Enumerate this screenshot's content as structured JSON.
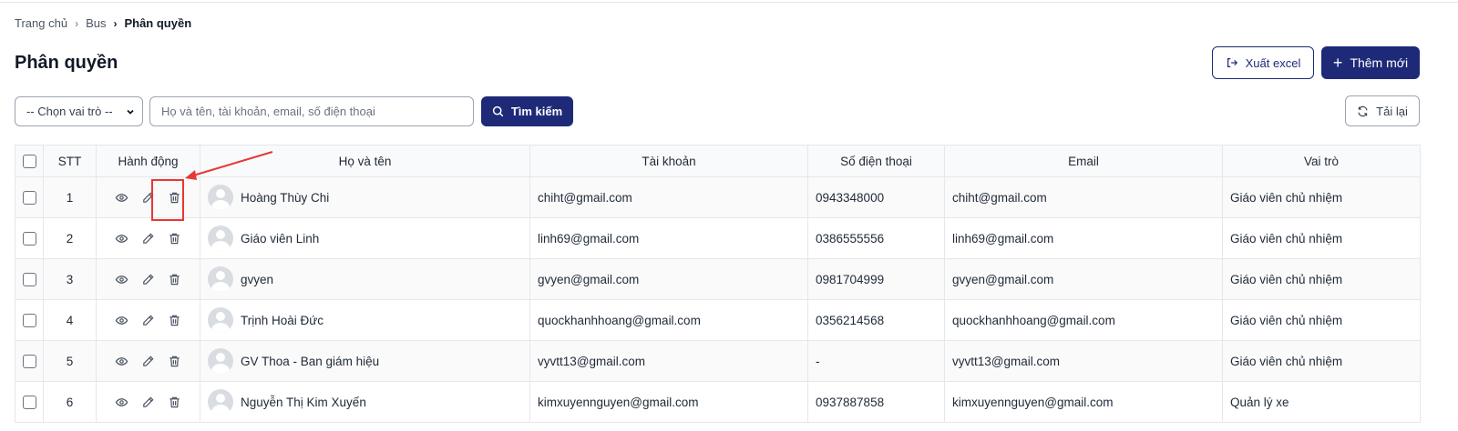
{
  "breadcrumb": {
    "home": "Trang chủ",
    "level1": "Bus",
    "current": "Phân quyền"
  },
  "page": {
    "title": "Phân quyền"
  },
  "toolbar": {
    "export_label": "Xuất excel",
    "add_label": "Thêm mới",
    "reload_label": "Tải lại"
  },
  "filters": {
    "role_select_value": "-- Chọn vai trò --",
    "search_placeholder": "Họ và tên, tài khoản, email, số điện thoại",
    "search_button": "Tìm kiếm"
  },
  "table": {
    "headers": {
      "stt": "STT",
      "actions": "Hành động",
      "name": "Họ và tên",
      "account": "Tài khoản",
      "phone": "Số điện thoại",
      "email": "Email",
      "role": "Vai trò"
    },
    "rows": [
      {
        "stt": "1",
        "name": "Hoàng Thùy Chi",
        "account": "chiht@gmail.com",
        "phone": "0943348000",
        "email": "chiht@gmail.com",
        "role": "Giáo viên chủ nhiệm"
      },
      {
        "stt": "2",
        "name": "Giáo viên Linh",
        "account": "linh69@gmail.com",
        "phone": "0386555556",
        "email": "linh69@gmail.com",
        "role": "Giáo viên chủ nhiệm"
      },
      {
        "stt": "3",
        "name": "gvyen",
        "account": "gvyen@gmail.com",
        "phone": "0981704999",
        "email": "gvyen@gmail.com",
        "role": "Giáo viên chủ nhiệm"
      },
      {
        "stt": "4",
        "name": "Trịnh Hoài Đức",
        "account": "quockhanhhoang@gmail.com",
        "phone": "0356214568",
        "email": "quockhanhhoang@gmail.com",
        "role": "Giáo viên chủ nhiệm"
      },
      {
        "stt": "5",
        "name": "GV Thoa - Ban giám hiệu",
        "account": "vyvtt13@gmail.com",
        "phone": "-",
        "email": "vyvtt13@gmail.com",
        "role": "Giáo viên chủ nhiệm"
      },
      {
        "stt": "6",
        "name": "Nguyễn Thị Kim Xuyến",
        "account": "kimxuyennguyen@gmail.com",
        "phone": "0937887858",
        "email": "kimxuyennguyen@gmail.com",
        "role": "Quản lý xe"
      }
    ]
  },
  "colors": {
    "primary": "#1e2a78",
    "annotation": "#e53935"
  }
}
